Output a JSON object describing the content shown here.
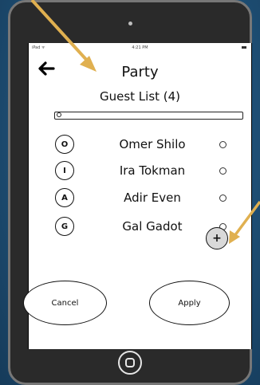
{
  "status_bar": {
    "carrier": "iPad ᯤ",
    "time": "4:21 PM"
  },
  "header": {
    "title": "Party",
    "subtitle": "Guest List (4)"
  },
  "search": {
    "value": "",
    "placeholder": ""
  },
  "guests": [
    {
      "initial": "O",
      "name": "Omer Shilo"
    },
    {
      "initial": "I",
      "name": "Ira Tokman"
    },
    {
      "initial": "A",
      "name": "Adir Even"
    },
    {
      "initial": "G",
      "name": "Gal Gadot"
    }
  ],
  "actions": {
    "add_label": "+",
    "cancel_label": "Cancel",
    "apply_label": "Apply"
  },
  "colors": {
    "background": "#1e4f75",
    "device": "#2a2a2a",
    "annotation_arrow": "#e0b050",
    "add_button": "#d9d9d9"
  },
  "icons": {
    "back": "arrow-left-icon",
    "search": "search-icon",
    "home": "home-button-icon"
  }
}
